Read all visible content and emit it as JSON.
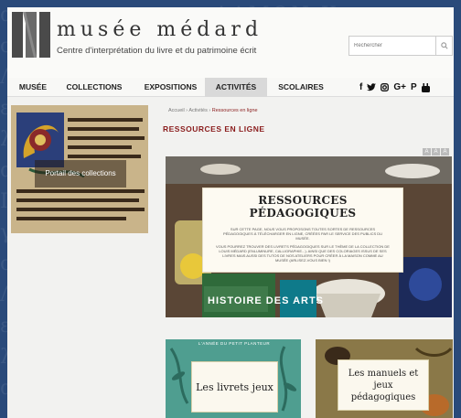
{
  "site": {
    "name": "musée médard",
    "tagline": "Centre d'interprétation du livre et du patrimoine écrit"
  },
  "search": {
    "placeholder": "Rechercher"
  },
  "nav": {
    "items": [
      {
        "label": "MUSÉE"
      },
      {
        "label": "COLLECTIONS"
      },
      {
        "label": "EXPOSITIONS"
      },
      {
        "label": "ACTIVITÉS",
        "active": true
      },
      {
        "label": "SCOLAIRES"
      }
    ],
    "social": [
      "f",
      "t",
      "o",
      "G+",
      "P",
      "y"
    ]
  },
  "sidebar": {
    "label": "Portail des collections"
  },
  "breadcrumb": {
    "home": "Accueil",
    "sep": "›",
    "parent": "Activités",
    "current": "Ressources en ligne"
  },
  "page_title": "RESSOURCES EN LIGNE",
  "font_size_controls": [
    "A",
    "A",
    "A"
  ],
  "hero": {
    "title": "RESSOURCES PÉDAGOGIQUES",
    "text1": "SUR CETTE PAGE, NOUS VOUS PROPOSONS TOUTES SORTES DE RESSOURCES PÉDAGOGIQUES À TÉLÉCHARGER EN LIGNE, CRÉÉES PAR LE SERVICE DES PUBLICS DU MUSÉE.",
    "text2": "VOUS POURREZ TROUVER DES LIVRETS PÉDAGOGIQUES SUR LE THÈME DE LA COLLECTION DE LOUIS MÉDARD (ENLUMINURE, CALLIGRAPHIE...). AINSI QUE DES COLORIAGES ISSUS DE SES LIVRES MAIS AUSSI DES TUTOS DE NOS ATELIERS POUR CRÉER À LA MAISON COMME AU MUSÉE (ARLISEZ-VOUS BIEN !)",
    "book_text": "HISTOIRE DES ARTS"
  },
  "cards": [
    {
      "label": "Les livrets jeux",
      "top_text": "L'ANNÉE DU PETIT PLANTEUR"
    },
    {
      "label": "Les manuels et jeux pédagogiques"
    }
  ],
  "colors": {
    "accent": "#8a1c1c",
    "nav_active": "#d9d9d9",
    "page_bg": "#2a4a7a"
  }
}
